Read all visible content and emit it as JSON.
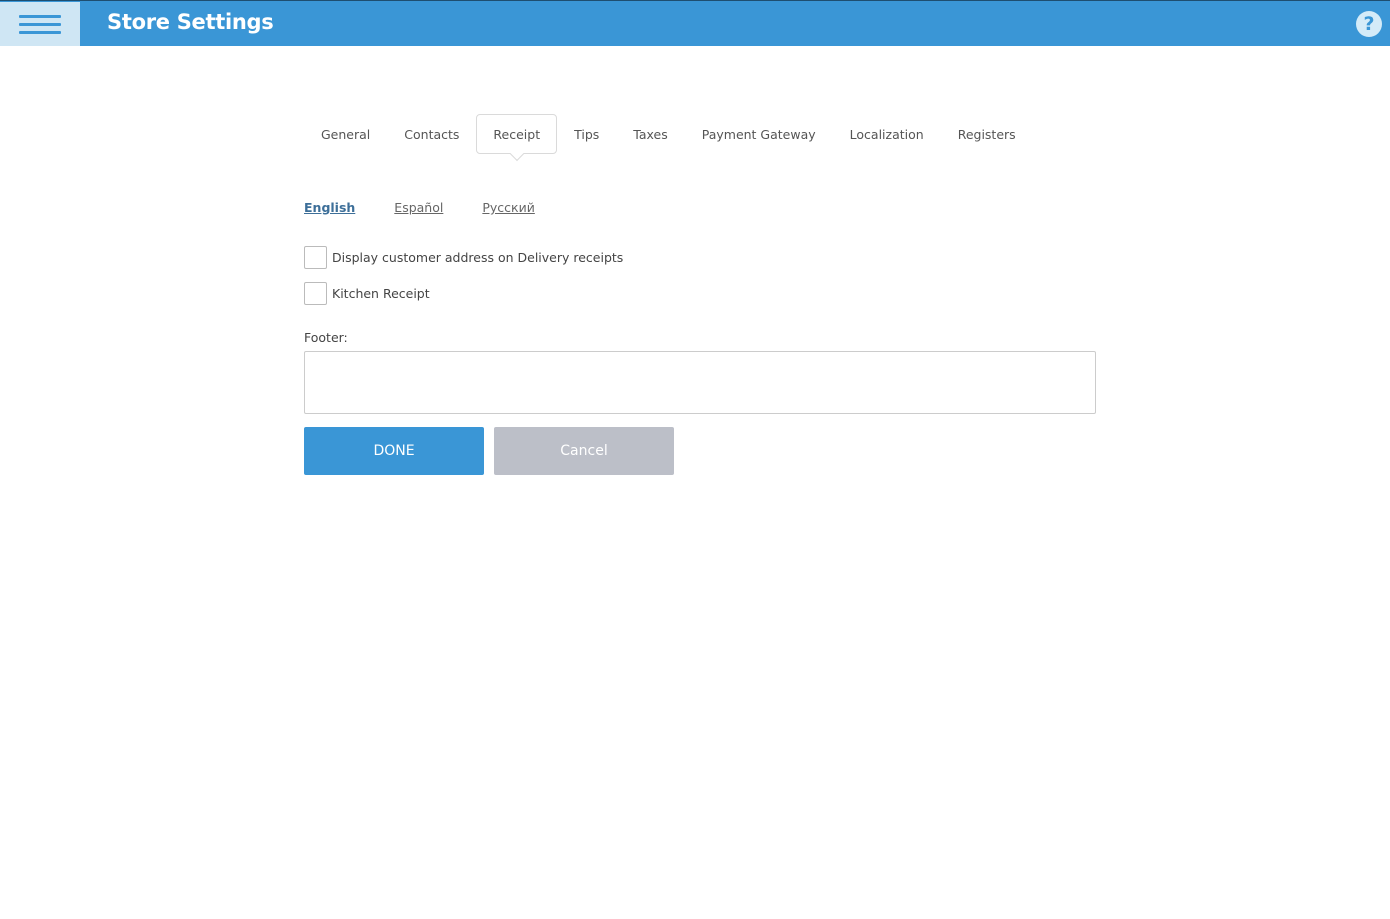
{
  "header": {
    "title": "Store Settings",
    "menu_icon": "hamburger-menu-icon",
    "help_icon": "help-question-icon",
    "help_glyph": "?",
    "colors": {
      "bar": "#3a96d6",
      "menu_bg": "#cfe6f4"
    }
  },
  "tabs": [
    {
      "label": "General",
      "active": false
    },
    {
      "label": "Contacts",
      "active": false
    },
    {
      "label": "Receipt",
      "active": true
    },
    {
      "label": "Tips",
      "active": false
    },
    {
      "label": "Taxes",
      "active": false
    },
    {
      "label": "Payment Gateway",
      "active": false
    },
    {
      "label": "Localization",
      "active": false
    },
    {
      "label": "Registers",
      "active": false
    }
  ],
  "languages": [
    {
      "label": "English",
      "active": true
    },
    {
      "label": "Español",
      "active": false
    },
    {
      "label": "Русский",
      "active": false
    }
  ],
  "options": [
    {
      "label": "Display customer address on Delivery receipts",
      "checked": false
    },
    {
      "label": "Kitchen Receipt",
      "checked": false
    }
  ],
  "footer": {
    "label": "Footer:",
    "value": "",
    "placeholder": ""
  },
  "actions": {
    "done_label": "DONE",
    "cancel_label": "Cancel"
  }
}
